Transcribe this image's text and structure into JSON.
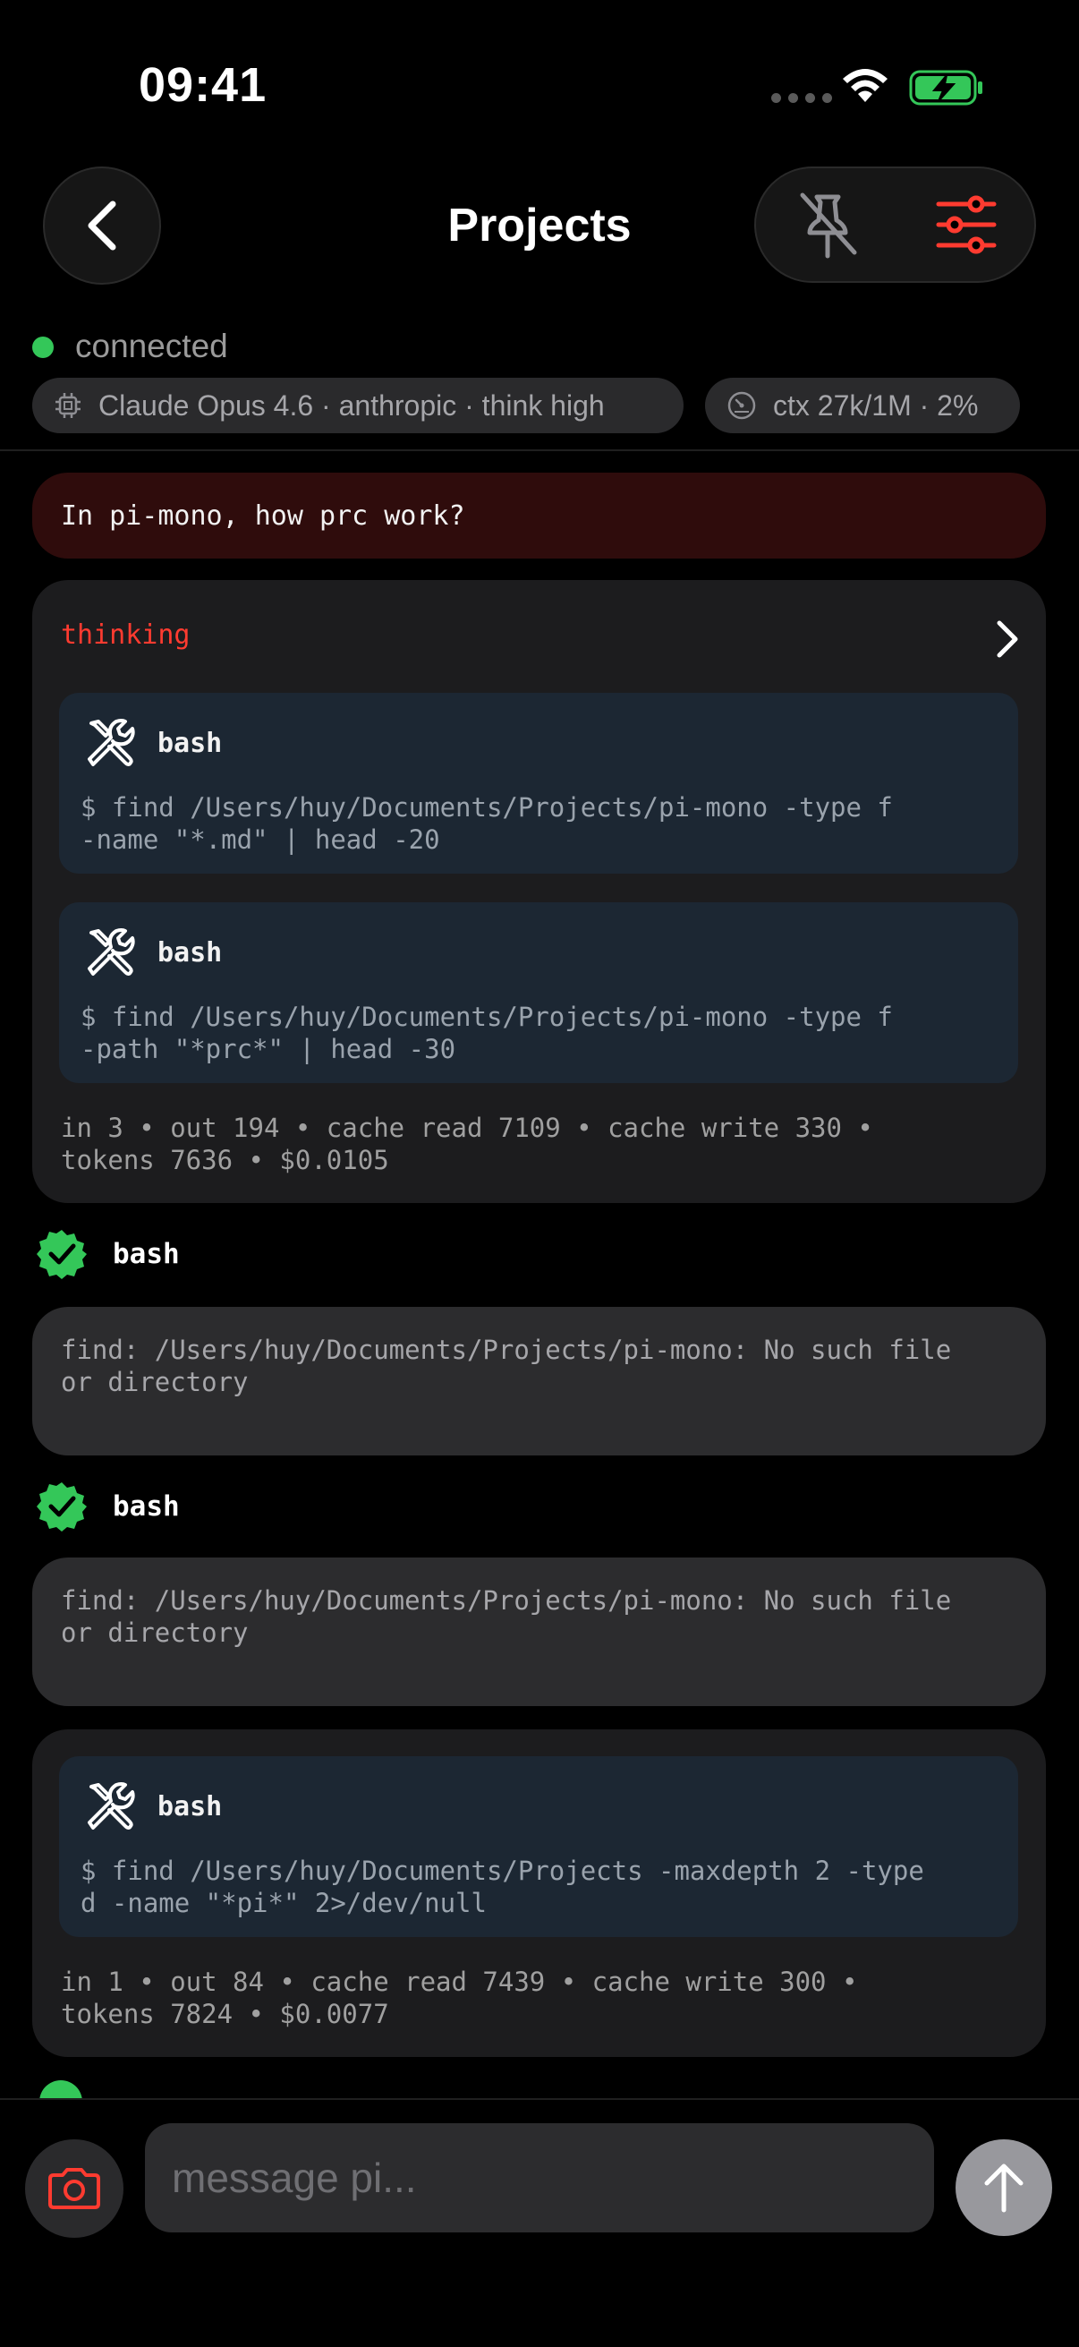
{
  "status_bar": {
    "time": "09:41"
  },
  "header": {
    "title": "Projects"
  },
  "connection": {
    "status": "connected",
    "model_chip": "Claude Opus 4.6 · anthropic · think high",
    "context_chip": "ctx 27k/1M · 2%"
  },
  "chat": {
    "user_message": "In pi-mono, how prc work?",
    "turn1": {
      "thinking_label": "thinking",
      "tools": [
        {
          "name": "bash",
          "command": "$ find /Users/huy/Documents/Projects/pi-mono -type f\n-name \"*.md\" | head -20"
        },
        {
          "name": "bash",
          "command": "$ find /Users/huy/Documents/Projects/pi-mono -type f\n-path \"*prc*\" | head -30"
        }
      ],
      "usage": "in 3 • out 194 • cache read 7109 • cache write 330 •\ntokens 7636 • $0.0105"
    },
    "results": [
      {
        "title": "bash",
        "output": "find: /Users/huy/Documents/Projects/pi-mono: No such file\nor directory"
      },
      {
        "title": "bash",
        "output": "find: /Users/huy/Documents/Projects/pi-mono: No such file\nor directory"
      }
    ],
    "turn2": {
      "tools": [
        {
          "name": "bash",
          "command": "$ find /Users/huy/Documents/Projects -maxdepth 2 -type\nd -name \"*pi*\" 2>/dev/null"
        }
      ],
      "usage": "in 1 • out 84 • cache read 7439 • cache write 300 •\ntokens 7824 • $0.0077"
    }
  },
  "composer": {
    "placeholder": "message pi..."
  },
  "colors": {
    "accent_red": "#ff3b30",
    "success_green": "#34c759",
    "tool_bg": "#1c2733"
  },
  "icons": [
    "back-chevron-icon",
    "unpin-icon",
    "sliders-icon",
    "chip-icon",
    "gauge-icon",
    "chevron-right-icon",
    "tools-icon",
    "verified-check-icon",
    "camera-icon",
    "arrow-up-icon"
  ]
}
